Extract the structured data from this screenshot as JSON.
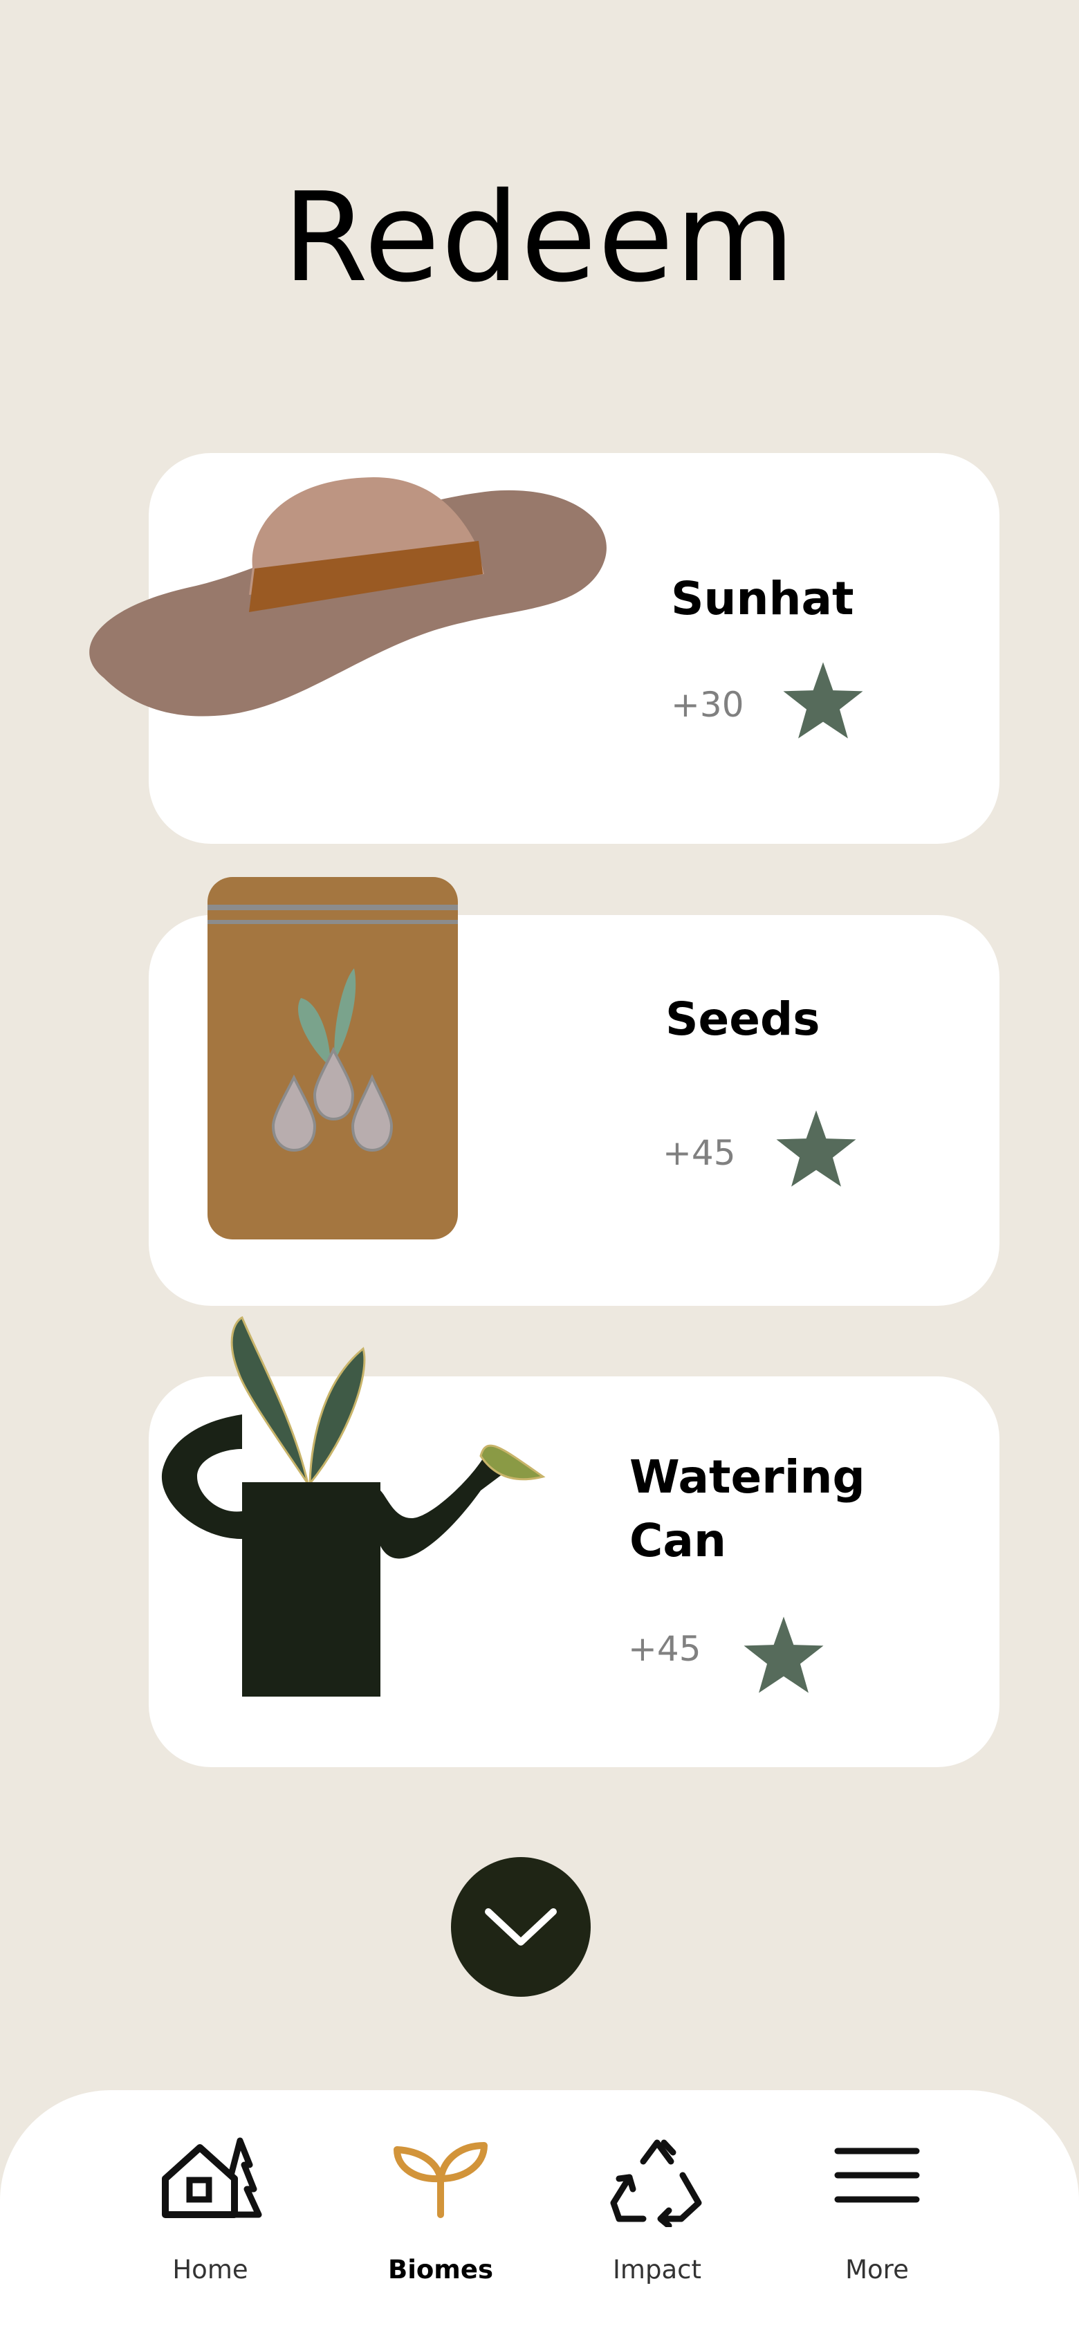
{
  "page": {
    "title": "Redeem"
  },
  "items": [
    {
      "name": "Sunhat",
      "points": "+30"
    },
    {
      "name": "Seeds",
      "points": "+45"
    },
    {
      "name_line1": "Watering",
      "name_line2": "Can",
      "points": "+45"
    }
  ],
  "colors": {
    "background": "#ede8df",
    "card": "#ffffff",
    "star": "#566b5b",
    "accent": "#d2943a",
    "dark": "#1f2515"
  },
  "nav": [
    {
      "label": "Home",
      "icon": "home-icon"
    },
    {
      "label": "Biomes",
      "icon": "sprout-icon",
      "active": true
    },
    {
      "label": "Impact",
      "icon": "recycle-icon"
    },
    {
      "label": "More",
      "icon": "menu-icon"
    }
  ],
  "scroll_button": {
    "icon": "chevron-down-icon"
  }
}
